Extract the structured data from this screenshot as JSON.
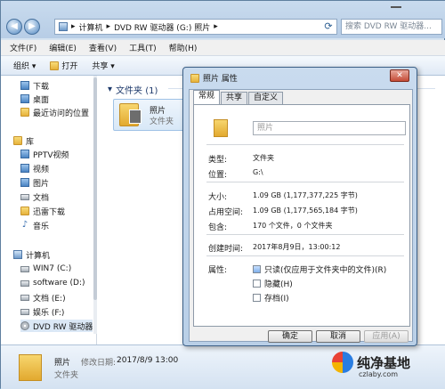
{
  "address": {
    "path": [
      "计算机",
      "DVD RW 驱动器 (G:) 照片"
    ],
    "search_placeholder": "搜索 DVD RW 驱动器..."
  },
  "menu": [
    "文件(F)",
    "编辑(E)",
    "查看(V)",
    "工具(T)",
    "帮助(H)"
  ],
  "toolbar": {
    "organize": "组织 ▾",
    "open": "打开",
    "share": "共享 ▾"
  },
  "nav": {
    "favorites": [
      "下载",
      "桌面",
      "最近访问的位置"
    ],
    "library_label": "库",
    "library": [
      "PPTV视频",
      "视频",
      "图片",
      "文档",
      "迅雷下载",
      "音乐"
    ],
    "computer_label": "计算机",
    "drives": [
      "WIN7 (C:)",
      "software (D:)",
      "文档 (E:)",
      "娱乐 (F:)",
      "DVD RW 驱动器"
    ]
  },
  "content": {
    "group_label": "文件夹 (1)",
    "item_name": "照片",
    "item_type": "文件夹"
  },
  "details": {
    "name": "照片",
    "modified_label": "修改日期:",
    "modified": "2017/8/9 13:00",
    "type": "文件夹"
  },
  "watermark": {
    "title": "纯净基地",
    "sub": "czlaby.com"
  },
  "dialog": {
    "title": "照片 属性",
    "close": "✕",
    "tabs": [
      "常规",
      "共享",
      "自定义"
    ],
    "name_value": "照片",
    "rows": [
      {
        "label": "类型:",
        "value": "文件夹"
      },
      {
        "label": "位置:",
        "value": "G:\\"
      },
      {
        "label": "大小:",
        "value": "1.09 GB (1,177,377,225 字节)"
      },
      {
        "label": "占用空间:",
        "value": "1.09 GB (1,177,565,184 字节)"
      },
      {
        "label": "包含:",
        "value": "170 个文件，0 个文件夹"
      },
      {
        "label": "创建时间:",
        "value": "2017年8月9日，13:00:12"
      },
      {
        "label": "属性:",
        "value": ""
      }
    ],
    "attributes": [
      {
        "label": "只读(仅应用于文件夹中的文件)(R)",
        "checked": true
      },
      {
        "label": "隐藏(H)",
        "checked": false
      },
      {
        "label": "存档(I)",
        "checked": false
      }
    ],
    "buttons": {
      "ok": "确定",
      "cancel": "取消",
      "apply": "应用(A)"
    }
  }
}
